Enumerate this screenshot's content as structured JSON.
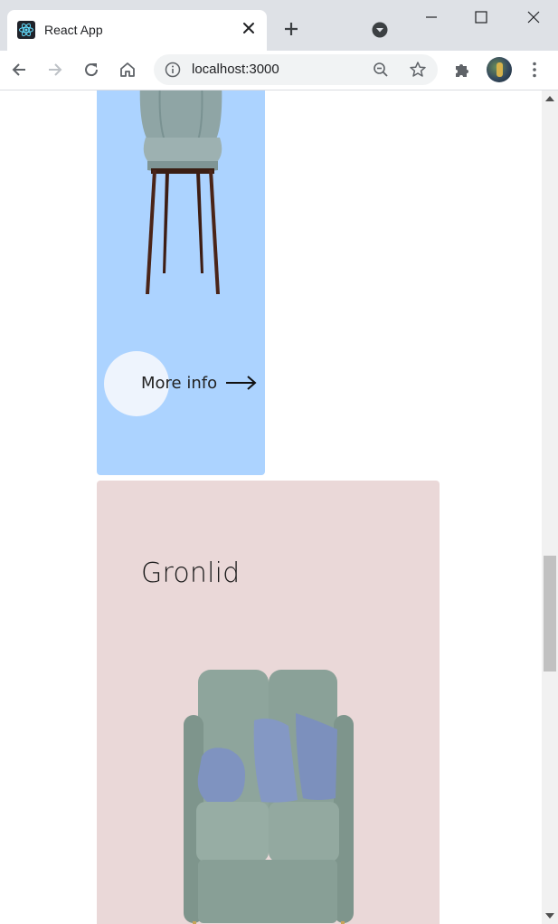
{
  "browser": {
    "tab_title": "React App",
    "url": "localhost:3000"
  },
  "icons": {
    "favicon": "react-logo-icon",
    "tab_close": "close-icon",
    "new_tab": "plus-icon",
    "tab_search": "chevron-down-circle-icon",
    "minimize": "minimize-icon",
    "maximize": "maximize-icon",
    "window_close": "close-icon",
    "back": "arrow-left-icon",
    "forward": "arrow-right-icon",
    "reload": "reload-icon",
    "home": "home-icon",
    "site_info": "info-icon",
    "zoom": "zoom-out-icon",
    "bookmark": "star-icon",
    "extensions": "puzzle-icon",
    "menu": "kebab-menu-icon"
  },
  "page": {
    "cards": [
      {
        "more_info": "More info",
        "color": "#acd3ff"
      },
      {
        "title": "Gronlid",
        "color": "#ead8d8"
      }
    ]
  },
  "scroll": {
    "position_fraction": 0.56
  }
}
